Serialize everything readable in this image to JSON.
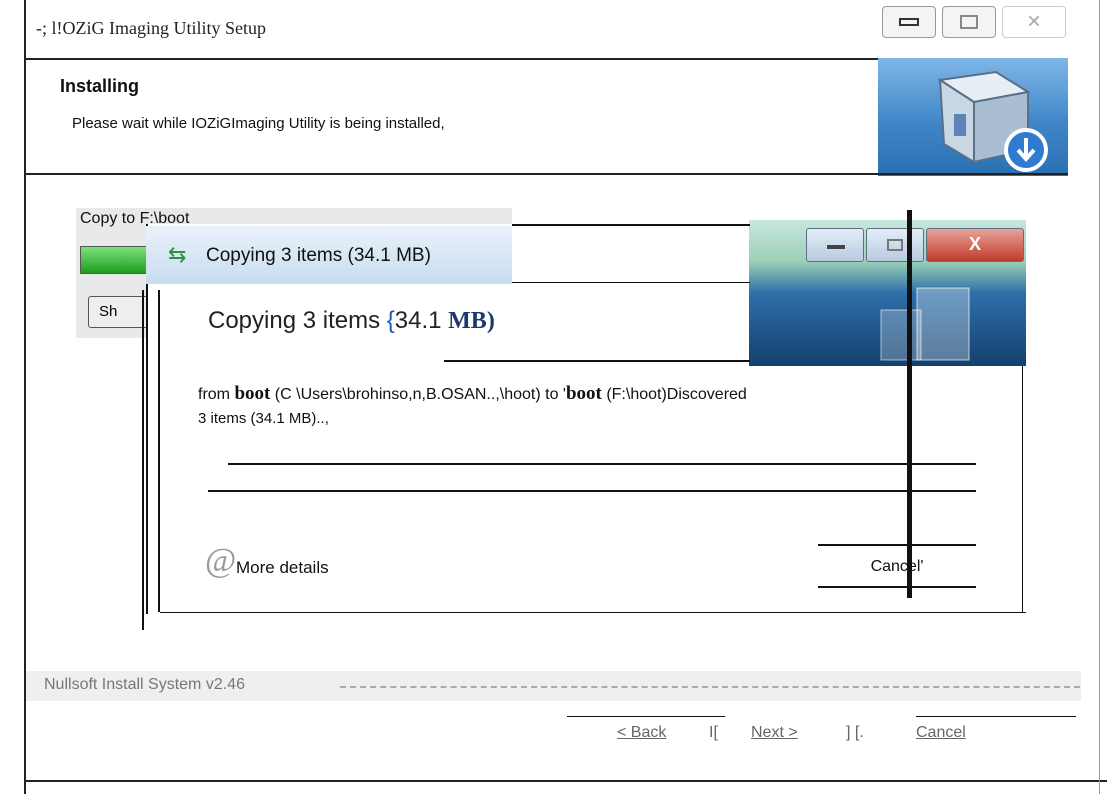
{
  "window": {
    "title": "-;  l!OZiG Imaging  Utility Setup",
    "minimize_glyph": "▭",
    "maximize_glyph": "◻",
    "close_glyph": "✕"
  },
  "header": {
    "title": "Installing",
    "subtitle": "Please wait  while IOZiGImaging Utility  is being installed,",
    "icon": "install-box-icon"
  },
  "background_panel": {
    "label": "Copy to F:\\boot",
    "show_button": "Sh"
  },
  "copy_dialog": {
    "title": "Copying 3 items (34.1 MB)",
    "title_icon": "copy-arrows-icon",
    "heading_prefix": "Copying 3 items ",
    "heading_brace": "{",
    "heading_num": "34.1",
    "heading_bold": "MB)",
    "from_prefix": "from ",
    "from_src": "boot",
    "from_mid": " (C \\Users\\brohinso,n,B.OSAN..,\\hoot) to '",
    "from_dst": "boot",
    "from_suffix": " (F:\\hoot)Discovered",
    "from_line2": "3 items (34.1 MB)..,",
    "more_icon": "@",
    "more_details": "More details",
    "cancel": "Cancel'",
    "controls": {
      "minimize": "—",
      "maximize": "▭",
      "close": "X"
    }
  },
  "footer": {
    "nsis": "Nullsoft Install System v2.46",
    "back": "< Back",
    "sep1": "I[",
    "next": "Next >",
    "sep2": "]  [.",
    "cancel": "Cancel"
  }
}
